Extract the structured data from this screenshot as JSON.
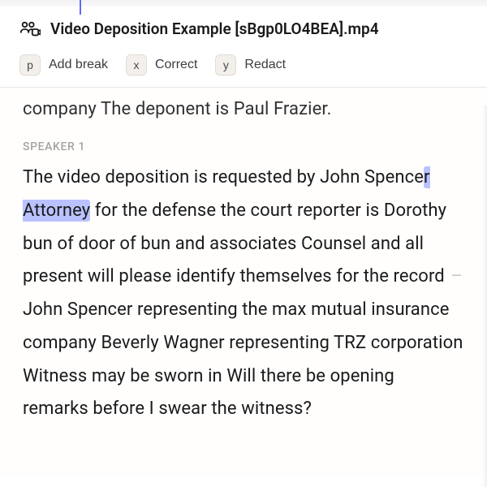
{
  "header": {
    "file_title": "Video Deposition Example [sBgp0LO4BEA].mp4"
  },
  "toolbar": {
    "add_break": {
      "key": "p",
      "label": "Add break"
    },
    "correct": {
      "key": "x",
      "label": "Correct"
    },
    "redact": {
      "key": "y",
      "label": "Redact"
    }
  },
  "transcript": {
    "cutoff_line": "company The deponent is Paul Frazier.",
    "speaker_label": "SPEAKER 1",
    "body_pre": "The video deposition is requested by John Spence",
    "body_highlight": "r Attorney",
    "body_mid": " for the defense the court reporter is Dorothy bun of door of bun and associates Counsel and all present will please identify themselves for the record ",
    "body_dash": "–",
    "body_post": " John Spencer representing the max mutual insurance company Beverly Wagner representing TRZ corporation Witness may be sworn in Will there be opening remarks before I swear the witness?"
  }
}
